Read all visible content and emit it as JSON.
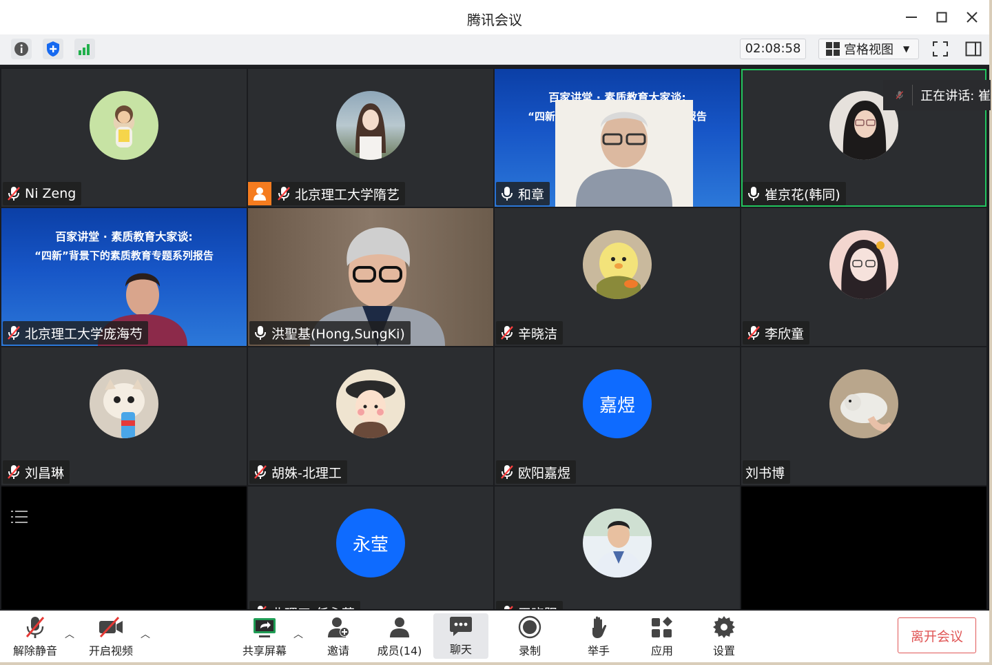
{
  "window": {
    "title": "腾讯会议"
  },
  "toolbar": {
    "timer": "02:08:58",
    "view_mode": "宫格视图"
  },
  "speaking_banner": {
    "text": "正在讲话: 崔"
  },
  "participants": [
    {
      "name": "Ni Zeng",
      "muted": true,
      "avatar": "girl-photo"
    },
    {
      "name": "北京理工大学隋艺",
      "muted": true,
      "host": true,
      "avatar": "woman-photo"
    },
    {
      "name": "和章",
      "muted": false,
      "avatar": "video-banner"
    },
    {
      "name": "崔京花(韩同)",
      "muted": false,
      "speaking": true,
      "avatar": "woman-glasses-photo"
    },
    {
      "name": "北京理工大学庞海芍",
      "muted": true,
      "avatar": "video-banner"
    },
    {
      "name": "洪聖基(Hong,SungKi)",
      "muted": false,
      "avatar": "video"
    },
    {
      "name": "辛晓洁",
      "muted": true,
      "avatar": "duck-toy-photo"
    },
    {
      "name": "李欣童",
      "muted": true,
      "avatar": "cartoon-girl"
    },
    {
      "name": "刘昌琳",
      "muted": true,
      "avatar": "cat-photo"
    },
    {
      "name": "胡姝-北理工",
      "muted": true,
      "avatar": "cartoon-hat"
    },
    {
      "name": "欧阳嘉煜",
      "muted": true,
      "avatar_text": "嘉煜"
    },
    {
      "name": "刘书博",
      "muted": null,
      "avatar": "cat-hand-photo"
    },
    {
      "name": "永莹",
      "avatar_text": "永莹",
      "label_partial": "北理工-任永莹"
    },
    {
      "name": "王晓阳",
      "avatar": "man-photo",
      "label_partial": "王晓阳"
    }
  ],
  "banner_text": {
    "line1": "百家讲堂 · 素质教育大家谈:",
    "line2": "“四新”背景下的素质教育专题系列报告"
  },
  "bottombar": {
    "unmute": "解除静音",
    "start_video": "开启视频",
    "share_screen": "共享屏幕",
    "invite": "邀请",
    "members": "成员(14)",
    "chat": "聊天",
    "record": "录制",
    "raise_hand": "举手",
    "apps": "应用",
    "settings": "设置",
    "leave": "离开会议"
  },
  "colors": {
    "accent_blue": "#0e6bff",
    "speaking_green": "#22c55e",
    "leave_red": "#e05656",
    "host_orange": "#f57c1f"
  }
}
